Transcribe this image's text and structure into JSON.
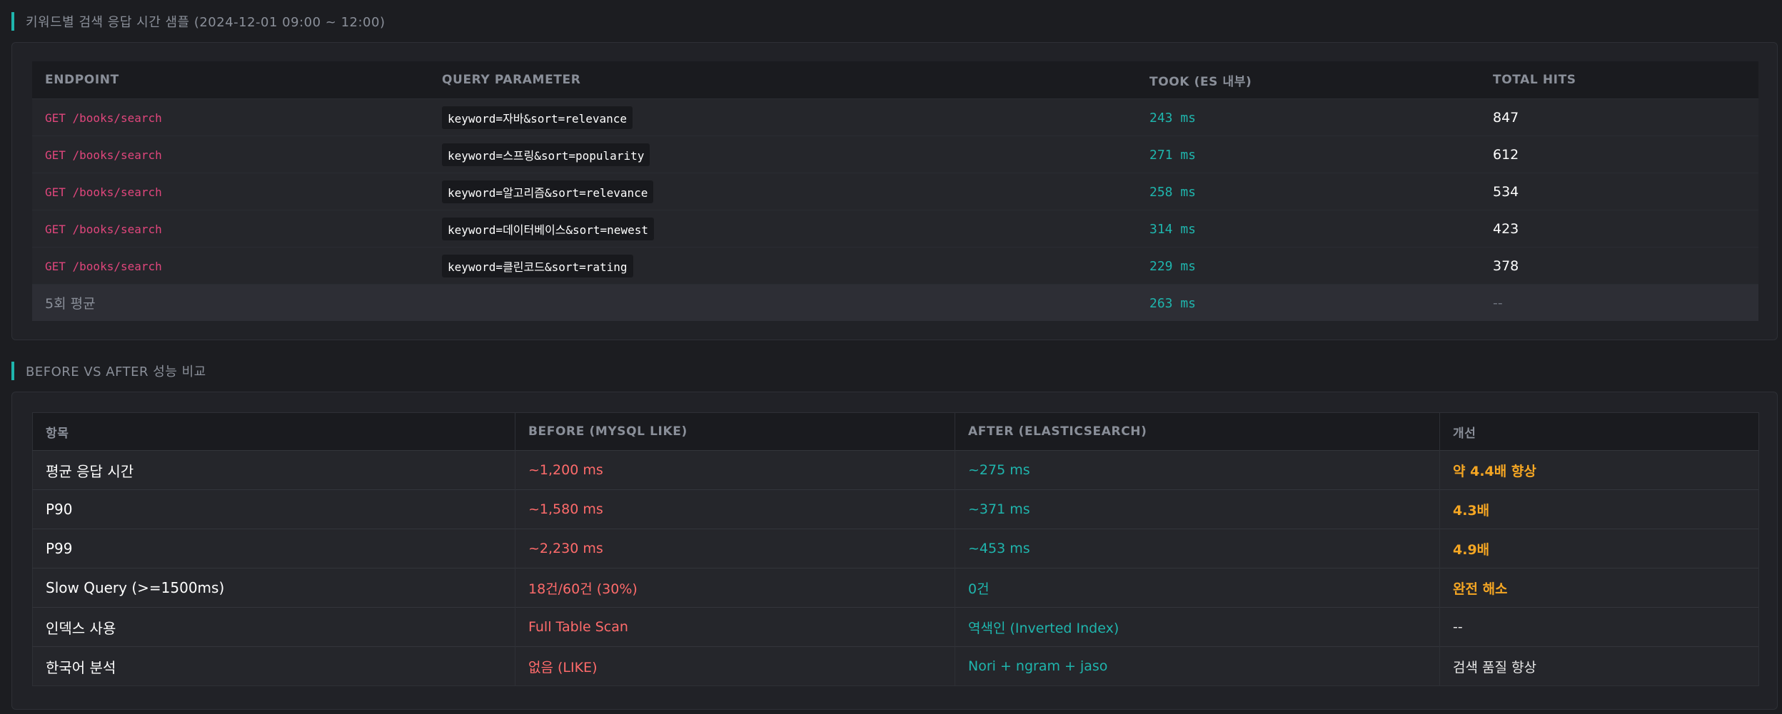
{
  "section1": {
    "title": "키워드별 검색 응답 시간 샘플 (2024-12-01 09:00 ~ 12:00)",
    "headers": [
      "ENDPOINT",
      "QUERY PARAMETER",
      "TOOK (ES 내부)",
      "TOTAL HITS"
    ],
    "rows": [
      {
        "endpoint": "GET /books/search",
        "param": "keyword=자바&sort=relevance",
        "took": "243 ms",
        "hits": "847"
      },
      {
        "endpoint": "GET /books/search",
        "param": "keyword=스프링&sort=popularity",
        "took": "271 ms",
        "hits": "612"
      },
      {
        "endpoint": "GET /books/search",
        "param": "keyword=알고리즘&sort=relevance",
        "took": "258 ms",
        "hits": "534"
      },
      {
        "endpoint": "GET /books/search",
        "param": "keyword=데이터베이스&sort=newest",
        "took": "314 ms",
        "hits": "423"
      },
      {
        "endpoint": "GET /books/search",
        "param": "keyword=클린코드&sort=rating",
        "took": "229 ms",
        "hits": "378"
      }
    ],
    "average": {
      "label": "5회 평균",
      "took": "263 ms",
      "hits": "--"
    }
  },
  "section2": {
    "title": "BEFORE VS AFTER 성능 비교",
    "headers": [
      "항목",
      "BEFORE (MYSQL LIKE)",
      "AFTER (ELASTICSEARCH)",
      "개선"
    ],
    "rows": [
      {
        "item": "평균 응답 시간",
        "before": "~1,200 ms",
        "after": "~275 ms",
        "improve": "약 4.4배 향상"
      },
      {
        "item": "P90",
        "before": "~1,580 ms",
        "after": "~371 ms",
        "improve": "4.3배"
      },
      {
        "item": "P99",
        "before": "~2,230 ms",
        "after": "~453 ms",
        "improve": "4.9배"
      },
      {
        "item": "Slow Query (>=1500ms)",
        "before": "18건/60건 (30%)",
        "after": "0건",
        "improve": "완전 해소"
      },
      {
        "item": "인덱스 사용",
        "before": "Full Table Scan",
        "after": "역색인 (Inverted Index)",
        "improve": "--"
      },
      {
        "item": "한국어 분석",
        "before": "없음 (LIKE)",
        "after": "Nori + ngram + jaso",
        "improve": "검색 품질 향상"
      }
    ]
  },
  "colors": {
    "accent": "#1fb5ad",
    "endpoint": "#e0467c",
    "before": "#ff6b6b",
    "improve": "#f5a623"
  }
}
